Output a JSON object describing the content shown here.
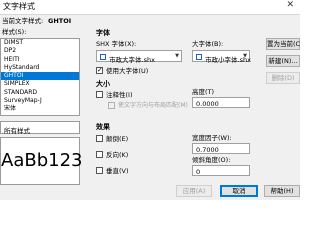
{
  "window": {
    "title": "文字样式",
    "close_glyph": "✕"
  },
  "current_style": {
    "label": "当前文字样式:",
    "value": "GHTOI"
  },
  "styles": {
    "label": "样式(S):",
    "items": [
      "DIMST",
      "DP2",
      "HEITI",
      "HyStandard",
      "GHTOI",
      "SIMPLEX",
      "STANDARD",
      "SurveyMap-J",
      "宋体"
    ],
    "selected_index": 4
  },
  "filter": {
    "value": "所有样式"
  },
  "preview": {
    "text": "AaBb123"
  },
  "font": {
    "section": "字体",
    "shx_label": "SHX 字体(X):",
    "shx_value": "市政大字体.shx",
    "big_label": "大字体(B):",
    "big_value": "市政小字体.shx",
    "use_big_font_label": "使用大字体(U)",
    "use_big_font_checked": true
  },
  "size": {
    "section": "大小",
    "annotative_label": "注释性(I)",
    "annotative_checked": false,
    "match_layout_label": "使文字方向与布局匹配(M)",
    "match_layout_checked": false,
    "height_label": "高度(T)",
    "height_value": "0.0000"
  },
  "effects": {
    "section": "效果",
    "upside_down_label": "颠倒(E)",
    "backwards_label": "反向(K)",
    "vertical_label": "垂直(V)",
    "width_factor_label": "宽度因子(W):",
    "width_factor_value": "0.7000",
    "oblique_label": "倾斜角度(O):",
    "oblique_value": "0"
  },
  "buttons": {
    "set_current": "置为当前(C)",
    "new": "新建(N)...",
    "delete": "删除(D)",
    "apply": "应用(A)",
    "cancel": "取消",
    "help": "帮助(H)"
  },
  "icons": {
    "font_icon": "truetype-font-icon",
    "dropdown": "chevron-down-icon"
  }
}
